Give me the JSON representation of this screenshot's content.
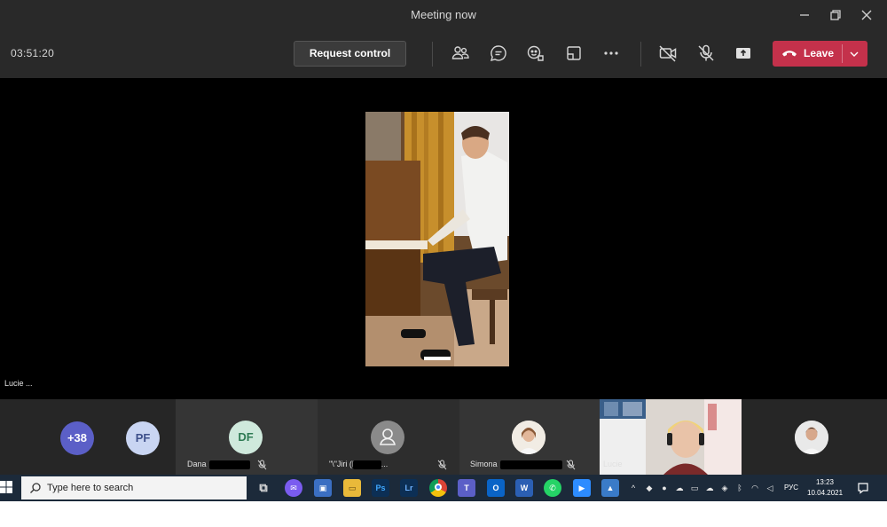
{
  "window": {
    "title": "Meeting now"
  },
  "toolbar": {
    "timer": "03:51:20",
    "request_control_label": "Request control",
    "leave_label": "Leave"
  },
  "stage": {
    "name": "Lucie ..."
  },
  "participants": {
    "overflow_count": "+38",
    "tiles": [
      {
        "initials": "PF",
        "name": ""
      },
      {
        "initials": "DF",
        "name": "Dana"
      },
      {
        "initials": "",
        "name": "\"\\\"Jiri            (Host)\\\"\" ..."
      },
      {
        "initials": "",
        "name": "Simona"
      },
      {
        "initials": "",
        "name": "Lucie"
      },
      {
        "initials": "",
        "name": ""
      }
    ]
  },
  "taskbar": {
    "search_placeholder": "Type here to search",
    "apps": [
      "task-view",
      "messenger",
      "store",
      "file-explorer",
      "photoshop",
      "lightroom",
      "chrome",
      "teams",
      "outlook",
      "word",
      "whatsapp",
      "zoom",
      "photos"
    ],
    "language": "РУС",
    "time": "13:23",
    "date": "10.04.2021"
  },
  "colors": {
    "leave": "#c4314b",
    "avatar_blue": "#5b5fc7",
    "avatar_light": "#c9d5f2",
    "avatar_green": "#cfe9dc"
  }
}
